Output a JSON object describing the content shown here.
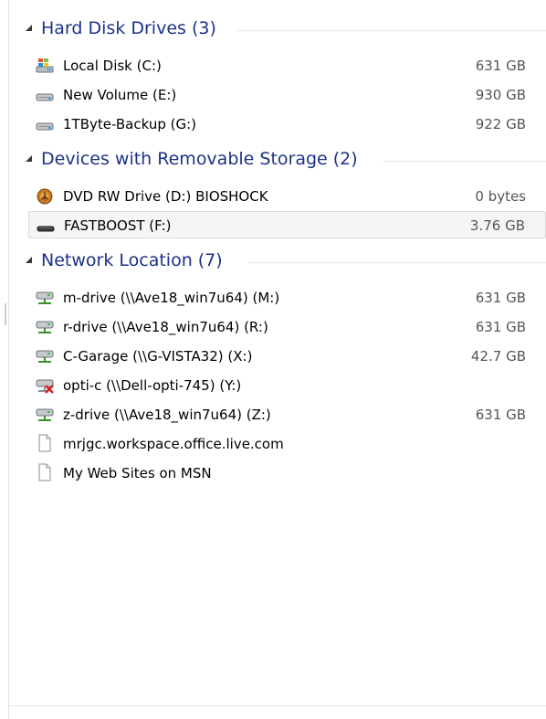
{
  "groups": [
    {
      "title": "Hard Disk Drives (3)",
      "items": [
        {
          "name": "Local Disk (C:)",
          "size": "631 GB",
          "icon": "windows-drive-icon"
        },
        {
          "name": "New Volume (E:)",
          "size": "930 GB",
          "icon": "hard-drive-icon"
        },
        {
          "name": "1TByte-Backup (G:)",
          "size": "922 GB",
          "icon": "hard-drive-icon"
        }
      ]
    },
    {
      "title": "Devices with Removable Storage (2)",
      "items": [
        {
          "name": "DVD RW Drive (D:) BIOSHOCK",
          "size": "0 bytes",
          "icon": "dvd-disc-icon"
        },
        {
          "name": "FASTBOOST (F:)",
          "size": "3.76 GB",
          "icon": "removable-drive-icon",
          "selected": true
        }
      ]
    },
    {
      "title": "Network Location (7)",
      "items": [
        {
          "name": "m-drive (\\\\Ave18_win7u64) (M:)",
          "size": "631 GB",
          "icon": "network-drive-icon"
        },
        {
          "name": "r-drive (\\\\Ave18_win7u64) (R:)",
          "size": "631 GB",
          "icon": "network-drive-icon"
        },
        {
          "name": "C-Garage (\\\\G-VISTA32) (X:)",
          "size": "42.7 GB",
          "icon": "network-drive-icon"
        },
        {
          "name": "opti-c (\\\\Dell-opti-745) (Y:)",
          "size": "",
          "icon": "disconnected-network-drive-icon"
        },
        {
          "name": "z-drive (\\\\Ave18_win7u64) (Z:)",
          "size": "631 GB",
          "icon": "network-drive-icon"
        },
        {
          "name": "mrjgc.workspace.office.live.com",
          "size": "",
          "icon": "web-folder-icon"
        },
        {
          "name": "My Web Sites on MSN",
          "size": "",
          "icon": "web-folder-icon"
        }
      ]
    }
  ],
  "colors": {
    "group_title": "#1e3287",
    "selected_row_bg": "#f5f5f5"
  }
}
